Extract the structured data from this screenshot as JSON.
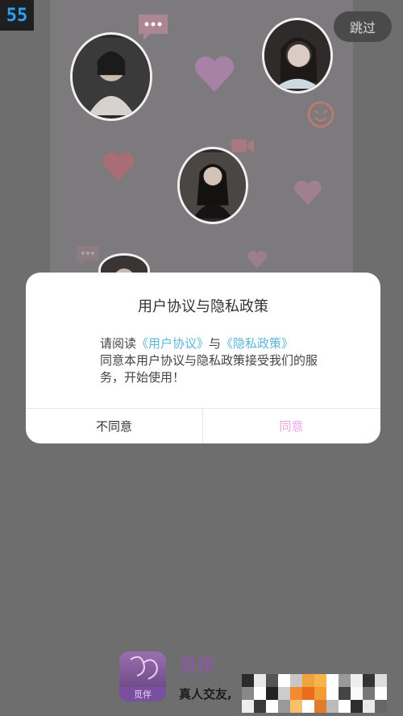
{
  "top_badge": "55",
  "skip_label": "跳过",
  "dialog": {
    "title": "用户协议与隐私政策",
    "body_prefix": "请阅读",
    "user_agreement_link": "《用户协议》",
    "conjunction": "与",
    "privacy_link": "《隐私政策》",
    "body_rest": "同意本用户协议与隐私政策接受我们的服务，开始使用！",
    "disagree_label": "不同意",
    "agree_label": "同意"
  },
  "app": {
    "name": "觅伴",
    "icon_tag": "觅伴",
    "tagline": "真人交友,"
  },
  "colors": {
    "link": "#5bb6d8",
    "agree": "#e9a4e4",
    "brand": "#8a5a9e"
  }
}
